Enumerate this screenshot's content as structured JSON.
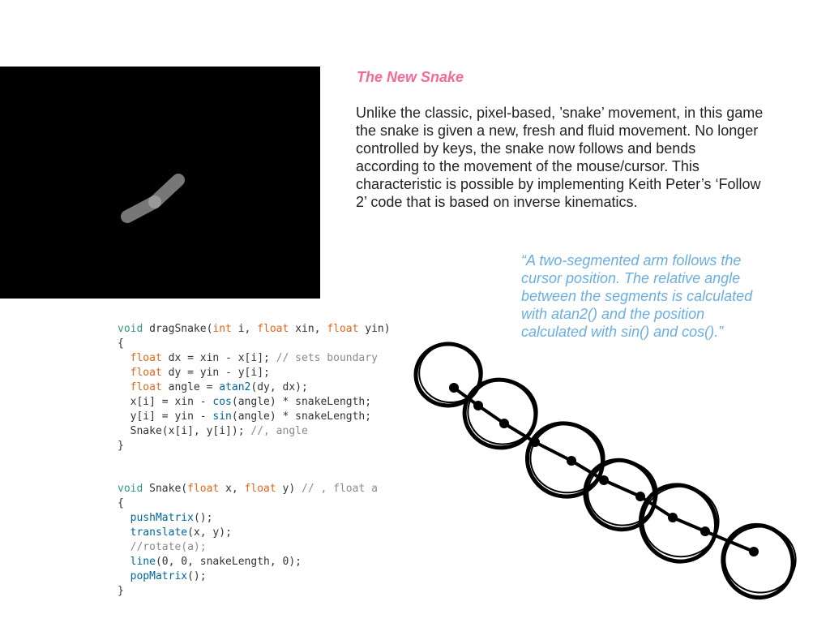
{
  "slide": {
    "title": "The New Snake",
    "paragraph_lines": [
      "Unlike the classic, pixel-based, ’snake’ movement, in this game",
      "the snake is given a new, fresh and fluid movement. No longer",
      "controlled by keys, the snake now follows and bends",
      "according to the movement of the mouse/cursor. This",
      "characteristic is possible by implementing Keith Peter’s ‘Follow",
      "2’ code that is based on inverse kinematics."
    ],
    "quote_lines": [
      "“A two-segmented arm follows the",
      "cursor position. The relative angle",
      "between the segments is calculated",
      "with atan2() and the position",
      "calculated with sin() and cos().”"
    ],
    "colors": {
      "title": "#f46a9b",
      "quote": "#6aaee0",
      "keyword_void": "#33997e",
      "keyword_type": "#e2661a",
      "function": "#006699",
      "comment": "#8a8a8a"
    }
  },
  "code_blocks": [
    [
      [
        [
          "void",
          "void"
        ],
        [
          "t",
          " dragSnake("
        ],
        [
          "type",
          "int"
        ],
        [
          "t",
          " i, "
        ],
        [
          "type",
          "float"
        ],
        [
          "t",
          " xin, "
        ],
        [
          "type",
          "float"
        ],
        [
          "t",
          " yin)"
        ]
      ],
      [
        [
          "t",
          "{"
        ]
      ],
      [
        [
          "t",
          "  "
        ],
        [
          "type",
          "float"
        ],
        [
          "t",
          " dx = xin - x[i]; "
        ],
        [
          "cm",
          "// sets boundary"
        ]
      ],
      [
        [
          "t",
          "  "
        ],
        [
          "type",
          "float"
        ],
        [
          "t",
          " dy = yin - y[i];"
        ]
      ],
      [
        [
          "t",
          "  "
        ],
        [
          "type",
          "float"
        ],
        [
          "t",
          " angle = "
        ],
        [
          "fn",
          "atan2"
        ],
        [
          "t",
          "(dy, dx);"
        ]
      ],
      [
        [
          "t",
          "  x[i] = xin - "
        ],
        [
          "fn",
          "cos"
        ],
        [
          "t",
          "(angle) * snakeLength;"
        ]
      ],
      [
        [
          "t",
          "  y[i] = yin - "
        ],
        [
          "fn",
          "sin"
        ],
        [
          "t",
          "(angle) * snakeLength;"
        ]
      ],
      [
        [
          "t",
          "  Snake(x[i], y[i]); "
        ],
        [
          "cm",
          "//, angle"
        ]
      ],
      [
        [
          "t",
          "}"
        ]
      ]
    ],
    [
      [
        [
          "void",
          "void"
        ],
        [
          "t",
          " Snake("
        ],
        [
          "type",
          "float"
        ],
        [
          "t",
          " x, "
        ],
        [
          "type",
          "float"
        ],
        [
          "t",
          " y) "
        ],
        [
          "cm",
          "// , float a"
        ]
      ],
      [
        [
          "t",
          "{"
        ]
      ],
      [
        [
          "t",
          "  "
        ],
        [
          "fn",
          "pushMatrix"
        ],
        [
          "t",
          "();"
        ]
      ],
      [
        [
          "t",
          "  "
        ],
        [
          "fn",
          "translate"
        ],
        [
          "t",
          "(x, y);"
        ]
      ],
      [
        [
          "t",
          "  "
        ],
        [
          "cm",
          "//rotate(a);"
        ]
      ],
      [
        [
          "t",
          "  "
        ],
        [
          "fn",
          "line"
        ],
        [
          "t",
          "(0, 0, snakeLength, 0);"
        ]
      ],
      [
        [
          "t",
          "  "
        ],
        [
          "fn",
          "popMatrix"
        ],
        [
          "t",
          "();"
        ]
      ],
      [
        [
          "t",
          "}"
        ]
      ]
    ]
  ]
}
